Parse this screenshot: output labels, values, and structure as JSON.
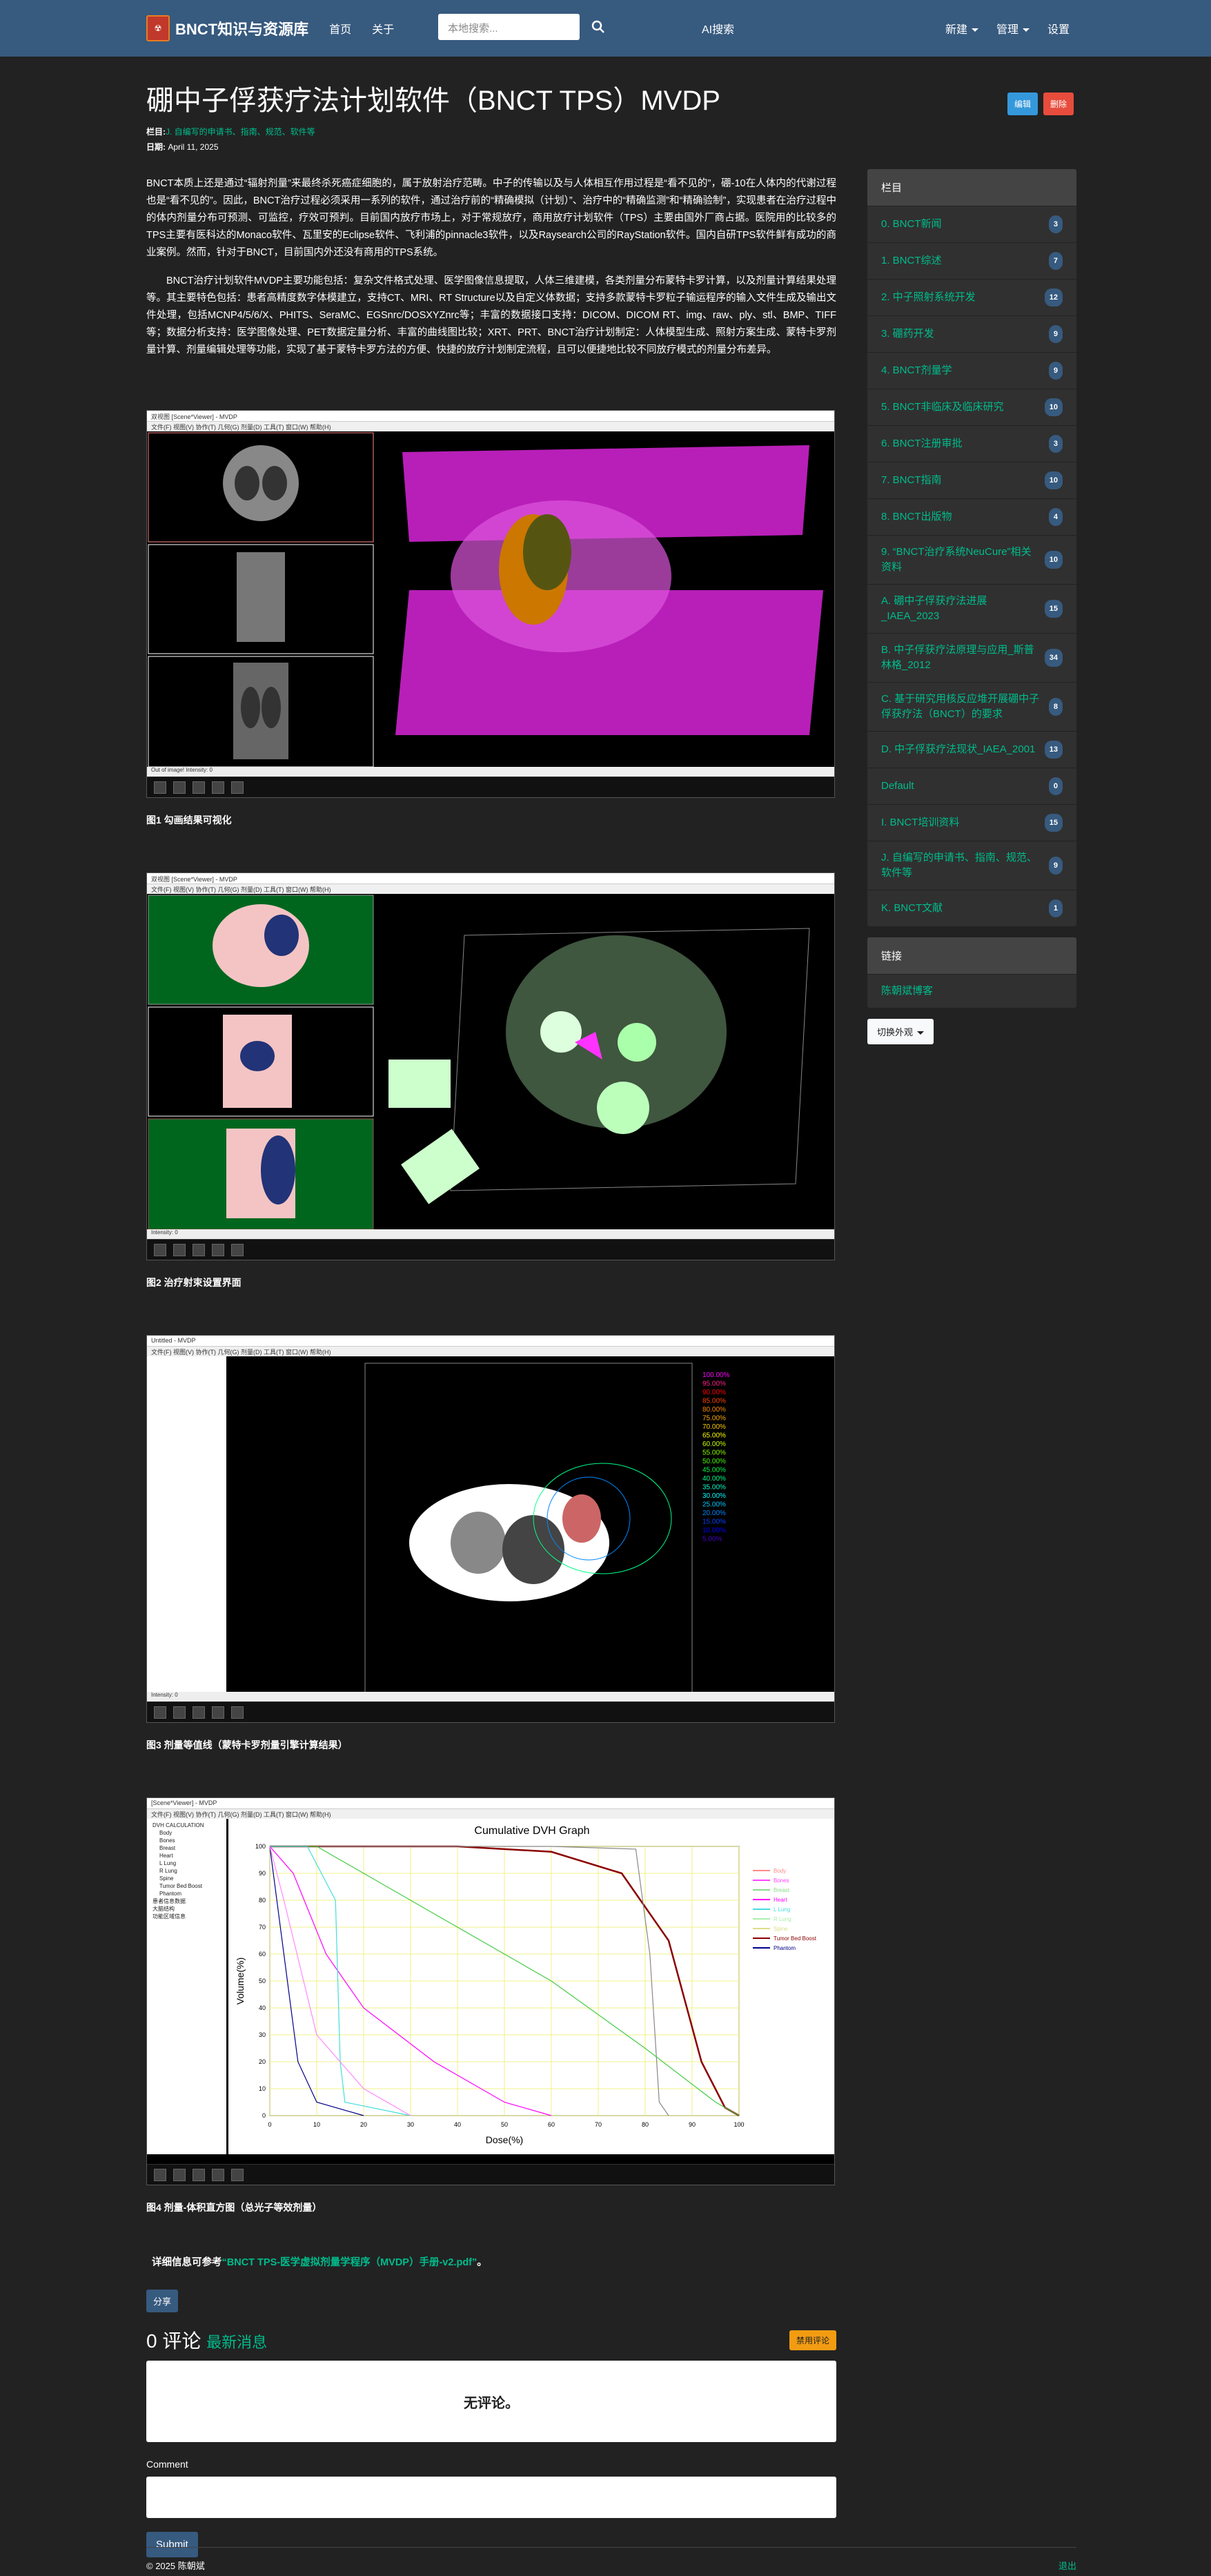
{
  "nav": {
    "brand": "BNCT知识与资源库",
    "links": [
      "首页",
      "关于"
    ],
    "search_placeholder": "本地搜索...",
    "ai": "AI搜索",
    "right": [
      "新建",
      "管理",
      "设置"
    ]
  },
  "post": {
    "title": "硼中子俘获疗法计划软件（BNCT TPS）MVDP",
    "edit": "编辑",
    "delete": "删除",
    "category_label": "栏目:",
    "category": "J. 自编写的申请书、指南、规范、软件等",
    "date_label": "日期:",
    "date": "April 11, 2025",
    "p1": "BNCT本质上还是通过“辐射剂量”来最终杀死癌症细胞的，属于放射治疗范畴。中子的传输以及与人体相互作用过程是“看不见的”，硼-10在人体内的代谢过程也是“看不见的”。因此，BNCT治疗过程必须采用一系列的软件，通过治疗前的“精确模拟（计划）”、治疗中的“精确监测”和“精确验制”，实现患者在治疗过程中的体内剂量分布可预测、可监控，疗效可预判。目前国内放疗市场上，对于常规放疗，商用放疗计划软件（TPS）主要由国外厂商占据。医院用的比较多的TPS主要有医科达的Monaco软件、瓦里安的Eclipse软件、飞利浦的pinnacle3软件，以及Raysearch公司的RayStation软件。国内自研TPS软件鲜有成功的商业案例。然而，针对于BNCT，目前国内外还没有商用的TPS系统。",
    "p2": "BNCT治疗计划软件MVDP主要功能包括：复杂文件格式处理、医学图像信息提取，人体三维建模，各类剂量分布蒙特卡罗计算，以及剂量计算结果处理等。其主要特色包括：患者高精度数字体模建立，支持CT、MRI、RT Structure以及自定义体数据；支持多款蒙特卡罗粒子输运程序的输入文件生成及输出文件处理，包括MCNP4/5/6/X、PHITS、SeraMC、EGSnrc/DOSXYZnrc等；丰富的数据接口支持：DICOM、DICOM RT、img、raw、ply、stl、BMP、TIFF等；数据分析支持：医学图像处理、PET数据定量分析、丰富的曲线图比较；XRT、PRT、BNCT治疗计划制定：人体模型生成、照射方案生成、蒙特卡罗剂量计算、剂量编辑处理等功能，实现了基于蒙特卡罗方法的方便、快捷的放疗计划制定流程，且可以便捷地比较不同放疗模式的剂量分布差异。",
    "figures": [
      {
        "caption": "图1 勾画结果可视化",
        "title": "双视图 [Scene*Viewer] - MVDP"
      },
      {
        "caption": "图2 治疗射束设置界面",
        "title": "双视图 [Scene*Viewer] - MVDP"
      },
      {
        "caption": "图3 剂量等值线（蒙特卡罗剂量引擎计算结果）",
        "title": "Untitled - MVDP"
      },
      {
        "caption": "图4 剂量-体积直方图（总光子等效剂量）",
        "title": "[Scene*Viewer] - MVDP"
      }
    ],
    "more_prefix": "详细信息可参考",
    "more_link": "“BNCT TPS-医学虚拟剂量学程序（MVDP）手册-v2.pdf”",
    "more_suffix": "。",
    "share": "分享"
  },
  "isodose": [
    "100.00%",
    "95.00%",
    "90.00%",
    "85.00%",
    "80.00%",
    "75.00%",
    "70.00%",
    "65.00%",
    "60.00%",
    "55.00%",
    "50.00%",
    "45.00%",
    "40.00%",
    "35.00%",
    "30.00%",
    "25.00%",
    "20.00%",
    "15.00%",
    "10.00%",
    "5.00%"
  ],
  "isodose_colors": [
    "#ff00ff",
    "#ff2288",
    "#ff0000",
    "#ff4400",
    "#ff8800",
    "#ffaa00",
    "#ffcc00",
    "#ffff00",
    "#ccff00",
    "#88ff00",
    "#44ff00",
    "#00ff44",
    "#00ff88",
    "#00ffcc",
    "#00ffff",
    "#00ccff",
    "#0088ff",
    "#0044ff",
    "#0000ff",
    "#4400cc"
  ],
  "dvh": {
    "title": "Cumulative DVH Graph",
    "xlabel": "Dose(%)",
    "ylabel": "Volume(%)",
    "xticks": [
      "0",
      "10",
      "20",
      "30",
      "40",
      "50",
      "60",
      "70",
      "80",
      "90",
      "100"
    ],
    "yticks": [
      "0",
      "10",
      "20",
      "30",
      "40",
      "50",
      "60",
      "70",
      "80",
      "90",
      "100"
    ],
    "legend": [
      "Body",
      "Bones",
      "Breast",
      "Heart",
      "L Lung",
      "R Lung",
      "Spine",
      "Tumor Bed Boost",
      "Phantom"
    ],
    "legend_colors": [
      "#ff8888",
      "#ff44ff",
      "#88dd88",
      "#ff00ff",
      "#44dddd",
      "#aaeeaa",
      "#dddd88",
      "#8b0000",
      "#000088"
    ],
    "tree": [
      "DVH CALCULATION",
      "Body",
      "Bones",
      "Breast",
      "Heart",
      "L Lung",
      "R Lung",
      "Spine",
      "Tumor Bed Boost",
      "Phantom",
      "患者信息数据",
      "大脑结构",
      "功能区域信息"
    ]
  },
  "comments": {
    "count_title": "0 评论",
    "latest": "最新消息",
    "ban": "禁用评论",
    "none": "无评论。",
    "label": "Comment",
    "submit": "Submit"
  },
  "sidebar": {
    "title": "栏目",
    "items": [
      {
        "label": "0. BNCT新闻",
        "count": "3"
      },
      {
        "label": "1. BNCT综述",
        "count": "7"
      },
      {
        "label": "2. 中子照射系统开发",
        "count": "12"
      },
      {
        "label": "3. 硼药开发",
        "count": "9"
      },
      {
        "label": "4. BNCT剂量学",
        "count": "9"
      },
      {
        "label": "5. BNCT非临床及临床研究",
        "count": "10"
      },
      {
        "label": "6. BNCT注册审批",
        "count": "3"
      },
      {
        "label": "7. BNCT指南",
        "count": "10"
      },
      {
        "label": "8. BNCT出版物",
        "count": "4"
      },
      {
        "label": "9. “BNCT治疗系统NeuCure”相关资料",
        "count": "10"
      },
      {
        "label": "A. 硼中子俘获疗法进展_IAEA_2023",
        "count": "15"
      },
      {
        "label": "B. 中子俘获疗法原理与应用_斯普林格_2012",
        "count": "34"
      },
      {
        "label": "C. 基于研究用核反应堆开展硼中子俘获疗法（BNCT）的要求",
        "count": "8"
      },
      {
        "label": "D. 中子俘获疗法现状_IAEA_2001",
        "count": "13"
      },
      {
        "label": "Default",
        "count": "0"
      },
      {
        "label": "I. BNCT培训资料",
        "count": "15"
      },
      {
        "label": "J. 自编写的申请书、指南、规范、软件等",
        "count": "9"
      },
      {
        "label": "K. BNCT文献",
        "count": "1"
      }
    ],
    "links_title": "链接",
    "links": [
      "陈朝斌博客"
    ],
    "theme": "切换外观"
  },
  "footer": {
    "copy": "© 2025 陈朝斌",
    "logout": "退出"
  }
}
